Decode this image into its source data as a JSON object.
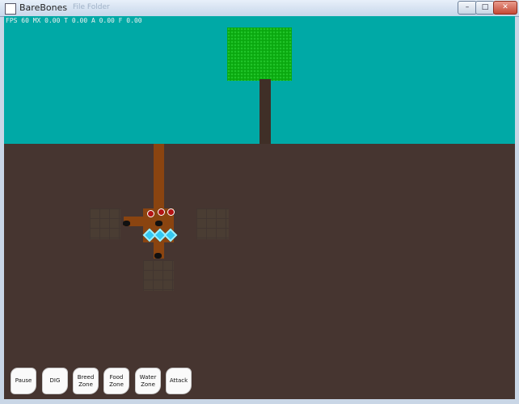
{
  "window": {
    "title": "BareBones",
    "ghost_title": "           File Folder",
    "buttons": {
      "minimize": "–",
      "maximize": "□",
      "close": "✕"
    }
  },
  "hud": {
    "text": "FPS 60  MX 0.00  T 0.00  A 0.00  F 0.00"
  },
  "colors": {
    "sky": "#00a9a6",
    "ground": "#463530",
    "tunnel": "#8a4410",
    "tree_crown": "#0aa80f",
    "tree_trunk": "#3f2f27"
  },
  "actions": [
    {
      "label": "Pause"
    },
    {
      "label": "DIG"
    },
    {
      "label": "Breed Zone"
    },
    {
      "label": "Food Zone"
    },
    {
      "label": "Water Zone"
    },
    {
      "label": "Attack"
    }
  ]
}
